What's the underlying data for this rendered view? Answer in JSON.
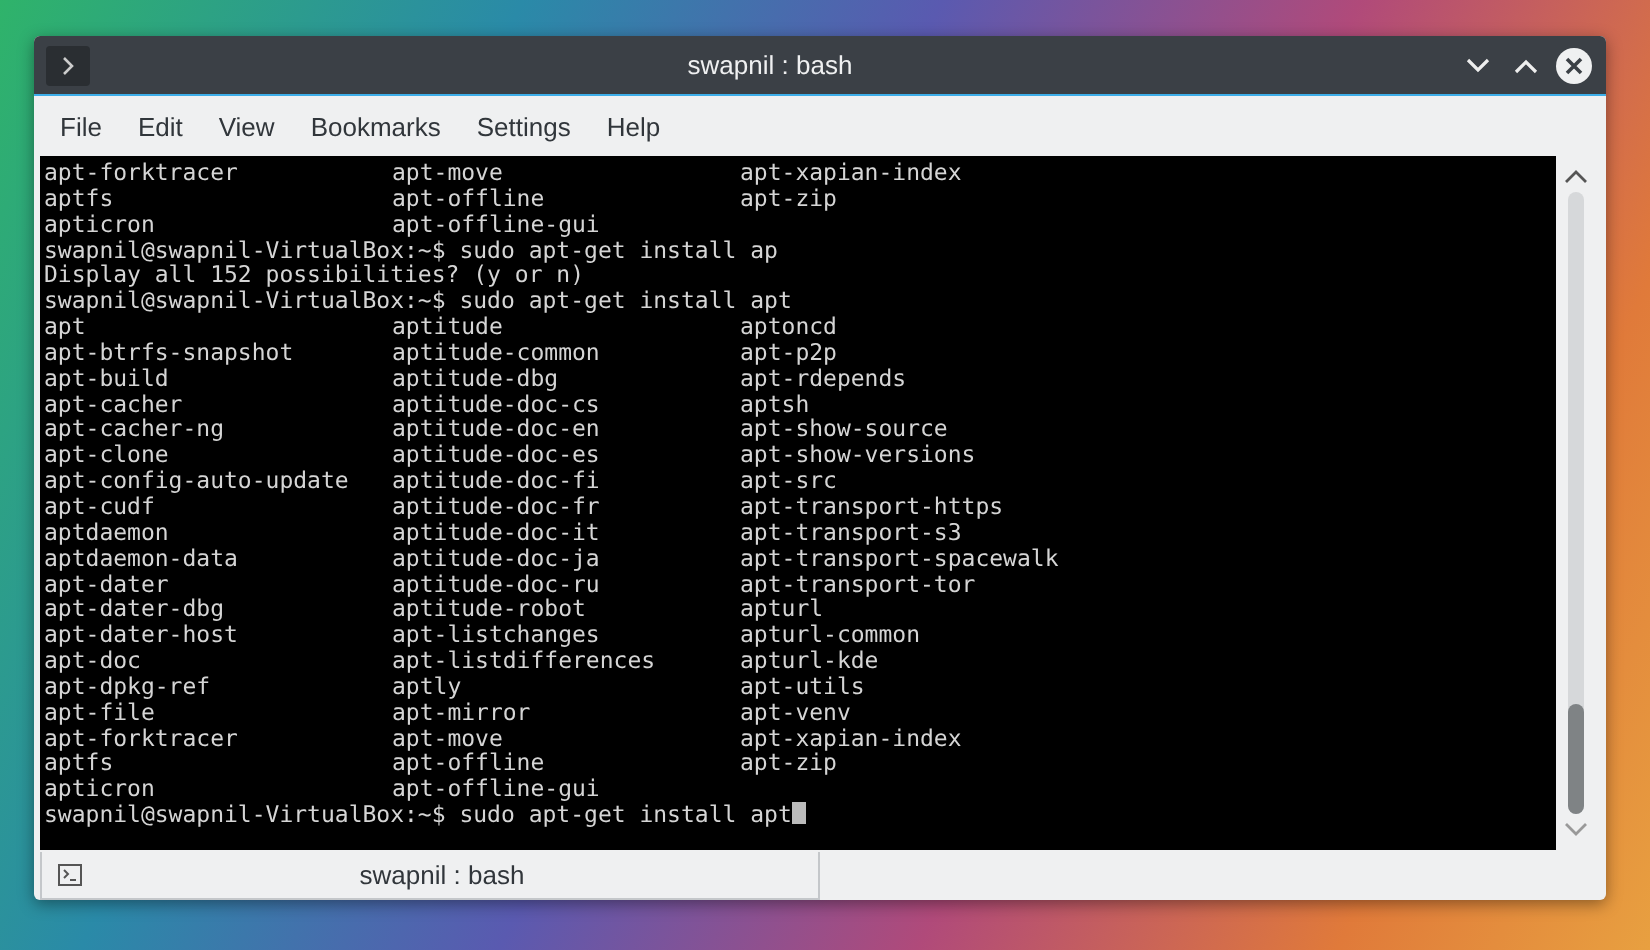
{
  "window": {
    "title": "swapnil : bash"
  },
  "menu": [
    "File",
    "Edit",
    "View",
    "Bookmarks",
    "Settings",
    "Help"
  ],
  "terminal": {
    "lines": [
      {
        "kind": "columns",
        "cells": [
          "apt-forktracer",
          "apt-move",
          "apt-xapian-index"
        ]
      },
      {
        "kind": "columns",
        "cells": [
          "aptfs",
          "apt-offline",
          "apt-zip"
        ]
      },
      {
        "kind": "columns",
        "cells": [
          "apticron",
          "apt-offline-gui"
        ]
      },
      {
        "kind": "text",
        "text": "swapnil@swapnil-VirtualBox:~$ sudo apt-get install ap",
        "cursor": false
      },
      {
        "kind": "text",
        "text": "Display all 152 possibilities? (y or n)",
        "cursor": false
      },
      {
        "kind": "text",
        "text": "swapnil@swapnil-VirtualBox:~$ sudo apt-get install apt",
        "cursor": false
      },
      {
        "kind": "columns",
        "cells": [
          "apt",
          "aptitude",
          "aptoncd"
        ]
      },
      {
        "kind": "columns",
        "cells": [
          "apt-btrfs-snapshot",
          "aptitude-common",
          "apt-p2p"
        ]
      },
      {
        "kind": "columns",
        "cells": [
          "apt-build",
          "aptitude-dbg",
          "apt-rdepends"
        ]
      },
      {
        "kind": "columns",
        "cells": [
          "apt-cacher",
          "aptitude-doc-cs",
          "aptsh"
        ]
      },
      {
        "kind": "columns",
        "cells": [
          "apt-cacher-ng",
          "aptitude-doc-en",
          "apt-show-source"
        ]
      },
      {
        "kind": "columns",
        "cells": [
          "apt-clone",
          "aptitude-doc-es",
          "apt-show-versions"
        ]
      },
      {
        "kind": "columns",
        "cells": [
          "apt-config-auto-update",
          "aptitude-doc-fi",
          "apt-src"
        ]
      },
      {
        "kind": "columns",
        "cells": [
          "apt-cudf",
          "aptitude-doc-fr",
          "apt-transport-https"
        ]
      },
      {
        "kind": "columns",
        "cells": [
          "aptdaemon",
          "aptitude-doc-it",
          "apt-transport-s3"
        ]
      },
      {
        "kind": "columns",
        "cells": [
          "aptdaemon-data",
          "aptitude-doc-ja",
          "apt-transport-spacewalk"
        ]
      },
      {
        "kind": "columns",
        "cells": [
          "apt-dater",
          "aptitude-doc-ru",
          "apt-transport-tor"
        ]
      },
      {
        "kind": "columns",
        "cells": [
          "apt-dater-dbg",
          "aptitude-robot",
          "apturl"
        ]
      },
      {
        "kind": "columns",
        "cells": [
          "apt-dater-host",
          "apt-listchanges",
          "apturl-common"
        ]
      },
      {
        "kind": "columns",
        "cells": [
          "apt-doc",
          "apt-listdifferences",
          "apturl-kde"
        ]
      },
      {
        "kind": "columns",
        "cells": [
          "apt-dpkg-ref",
          "aptly",
          "apt-utils"
        ]
      },
      {
        "kind": "columns",
        "cells": [
          "apt-file",
          "apt-mirror",
          "apt-venv"
        ]
      },
      {
        "kind": "columns",
        "cells": [
          "apt-forktracer",
          "apt-move",
          "apt-xapian-index"
        ]
      },
      {
        "kind": "columns",
        "cells": [
          "aptfs",
          "apt-offline",
          "apt-zip"
        ]
      },
      {
        "kind": "columns",
        "cells": [
          "apticron",
          "apt-offline-gui"
        ]
      },
      {
        "kind": "text",
        "text": "swapnil@swapnil-VirtualBox:~$ sudo apt-get install apt",
        "cursor": true
      }
    ]
  },
  "tabs": [
    {
      "label": "swapnil : bash",
      "selected": true
    }
  ]
}
